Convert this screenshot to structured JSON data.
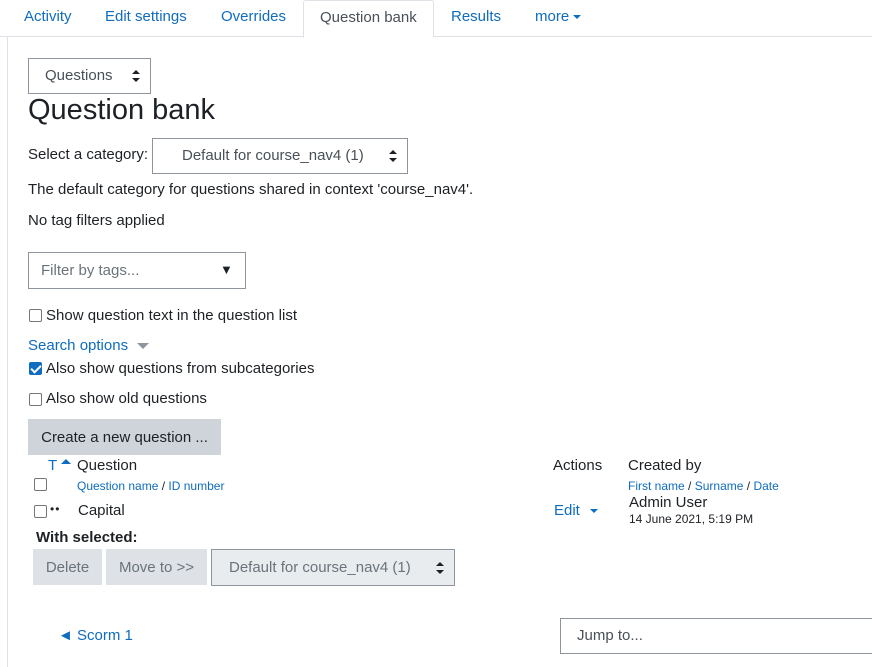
{
  "tabs": [
    "Activity",
    "Edit settings",
    "Overrides",
    "Question bank",
    "Results",
    "more"
  ],
  "page_select": "Questions",
  "heading": "Question bank",
  "category": {
    "label": "Select a category:",
    "value": "Default for course_nav4 (1)",
    "description": "The default category for questions shared in context 'course_nav4'."
  },
  "tags": {
    "status": "No tag filters applied",
    "placeholder": "Filter by tags...",
    "dropdown_glyph": "▼"
  },
  "options": {
    "show_question_text": "Show question text in the question list",
    "search_options": "Search options",
    "subcategories": "Also show questions from subcategories",
    "old_questions": "Also show old questions"
  },
  "create_button": "Create a new question ...",
  "table": {
    "type_header": "T",
    "question_header": "Question",
    "question_name_sort": "Question name",
    "sort_sep": "/",
    "id_number_sort": "ID number",
    "actions_header": "Actions",
    "created_by_header": "Created by",
    "first_name_sort": "First name",
    "surname_sort": "Surname",
    "date_sort": "Date",
    "rows": [
      {
        "type_glyph": "••",
        "question": "Capital",
        "action": "Edit",
        "created_by": "Admin User",
        "created_date": "14 June 2021, 5:19 PM"
      }
    ]
  },
  "bulk": {
    "label": "With selected:",
    "delete": "Delete",
    "move": "Move to >>",
    "target_category": "Default for course_nav4 (1)"
  },
  "footer": {
    "prev_link": "◄ Scorm 1",
    "jump_to": "Jump to..."
  },
  "colors": {
    "link": "#0f6cbf",
    "text": "#1d2125",
    "button_bg": "#ced4da",
    "checkbox_checked": "#0f6cbf"
  }
}
